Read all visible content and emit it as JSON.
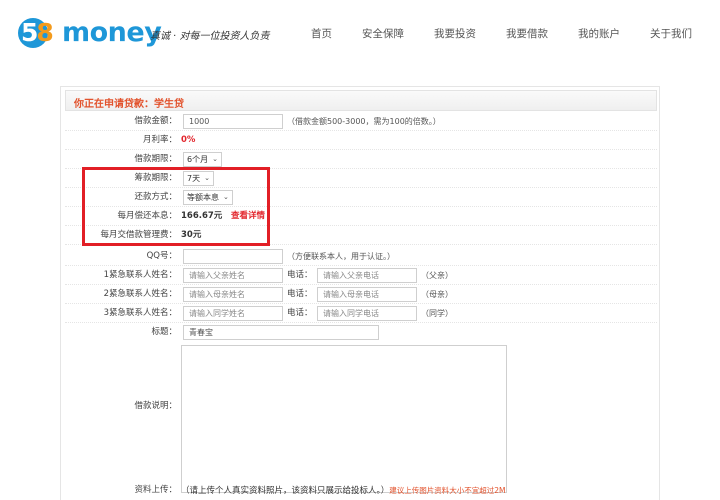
{
  "header": {
    "logo_digits_5": "5",
    "logo_digits_8": "8",
    "logo_word": "money",
    "slogan": "真诚 · 对每一位投资人负责",
    "nav": [
      "首页",
      "安全保障",
      "我要投资",
      "我要借款",
      "我的账户",
      "关于我们"
    ]
  },
  "form": {
    "title": "你正在申请贷款：学生贷",
    "amount": {
      "label": "借款金额：",
      "value": "1000",
      "hint": "（借款金额500-3000，需为100的倍数。）"
    },
    "rate": {
      "label": "月利率：",
      "value": "0%"
    },
    "term": {
      "label": "借款期限：",
      "value": "6个月"
    },
    "raise_period": {
      "label": "筹款期限：",
      "value": "7天"
    },
    "repay_method": {
      "label": "还款方式：",
      "value": "等额本息"
    },
    "monthly_payment": {
      "label": "每月偿还本息：",
      "value": "166.67元",
      "link": "查看详情"
    },
    "monthly_fee": {
      "label": "每月交借款管理费：",
      "value": "30元"
    },
    "qq": {
      "label": "QQ号：",
      "hint": "（方便联系本人，用于认证。）"
    },
    "contacts": [
      {
        "label": "1紧急联系人姓名：",
        "name_placeholder": "请输入父亲姓名",
        "phone_label": "电话：",
        "phone_placeholder": "请输入父亲电话",
        "relation": "（父亲）"
      },
      {
        "label": "2紧急联系人姓名：",
        "name_placeholder": "请输入母亲姓名",
        "phone_label": "电话：",
        "phone_placeholder": "请输入母亲电话",
        "relation": "（母亲）"
      },
      {
        "label": "3紧急联系人姓名：",
        "name_placeholder": "请输入同学姓名",
        "phone_label": "电话：",
        "phone_placeholder": "请输入同学电话",
        "relation": "（同学）"
      }
    ],
    "subject": {
      "label": "标题：",
      "value": "青春宝"
    },
    "description": {
      "label": "借款说明："
    },
    "upload": {
      "label": "资料上传：",
      "hint": "（请上传个人真实资料照片，该资料只展示给投标人。）",
      "note": "建议上传图片资料大小不宜超过2M"
    }
  },
  "colors": {
    "brand_blue": "#1e97d8",
    "brand_orange": "#f39a1c",
    "accent_red": "#e2252c",
    "highlight_red": "#e21f26"
  }
}
